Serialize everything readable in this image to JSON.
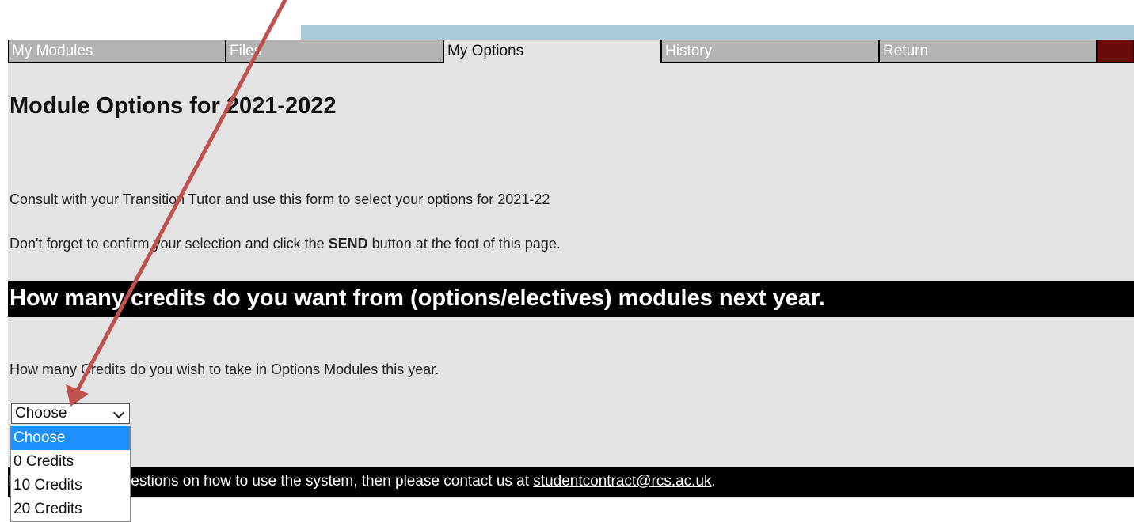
{
  "tabs": [
    {
      "label": "My Modules",
      "active": false
    },
    {
      "label": "Files",
      "active": false
    },
    {
      "label": "My Options",
      "active": true
    },
    {
      "label": "History",
      "active": false
    },
    {
      "label": "Return",
      "active": false
    }
  ],
  "main": {
    "title": "Module Options for 2021-2022",
    "intro": "Consult with your Transition Tutor and use this form to select your options for 2021-22",
    "reminder_prefix": "Don't forget to confirm your selection and click the ",
    "reminder_bold": "SEND",
    "reminder_suffix": " button at the foot of this page.",
    "section_title": "How many credits do you want from (options/electives) modules next year.",
    "question": "How many Credits do you wish to take in Options Modules this year."
  },
  "credits_select": {
    "value": "Choose",
    "options": [
      "Choose",
      "0 Credits",
      "10 Credits",
      "20 Credits"
    ]
  },
  "footer": {
    "text_prefix": "If you have any questions on how to use the system, then please contact us at ",
    "email": "studentcontract@rcs.ac.uk",
    "text_suffix": "."
  },
  "colors": {
    "tab_bg": "#b3b3b3",
    "active_tab_bg": "#e3e3e3",
    "panel_bg": "#e3e3e3",
    "bar_bg": "#000000",
    "end_block": "#6b0a0a",
    "annotation_arrow": "#c0504d",
    "selected_option": "#1e90ff"
  }
}
